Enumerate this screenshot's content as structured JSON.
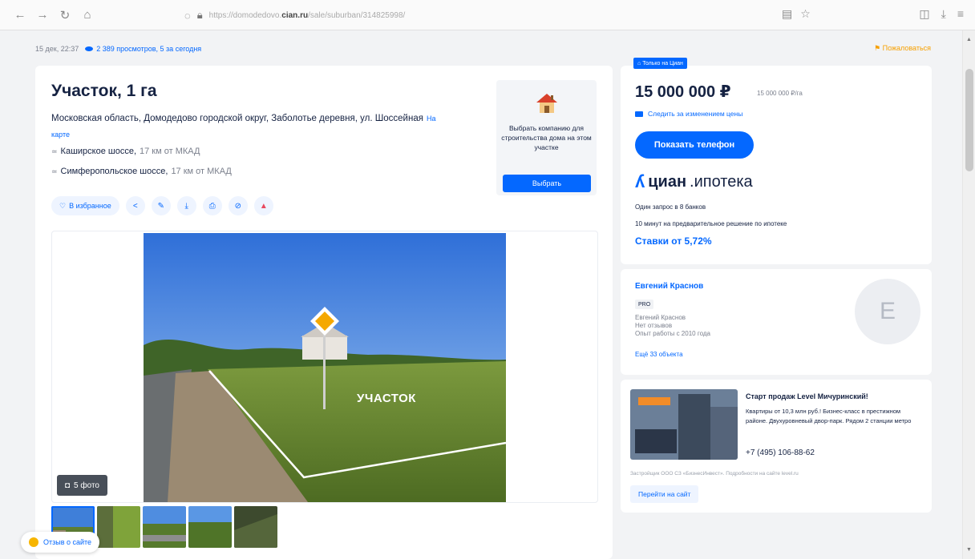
{
  "browser": {
    "url_prefix": "https://domodedovo.",
    "url_host": "cian.ru",
    "url_path": "/sale/suburban/314825998/"
  },
  "meta": {
    "date": "15 дек, 22:37",
    "views": "2 389 просмотров, 5 за сегодня",
    "complain": "Пожаловаться"
  },
  "listing": {
    "title": "Участок, 1 га",
    "address": "Московская область, Домодедово городской округ, Заболотье деревня, ул. Шоссейная",
    "map_link": "На карте",
    "highways": [
      {
        "name": "Каширское шоссе,",
        "distance": "17 км от МКАД"
      },
      {
        "name": "Симферопольское шоссе,",
        "distance": "17 км от МКАД"
      }
    ],
    "favorite": "В избранное"
  },
  "builder": {
    "text": "Выбрать компанию для строительства дома на этом участке",
    "button": "Выбрать"
  },
  "gallery": {
    "photo_label": "УЧАСТОК",
    "photo_count": "5 фото"
  },
  "feedback": "Отзыв о сайте",
  "price": {
    "badge": "Только на Циан",
    "amount": "15 000 000 ₽",
    "per_unit": "15 000 000 ₽/га",
    "watch": "Следить за изменением цены",
    "phone_button": "Показать телефон"
  },
  "mortgage": {
    "brand_main": "циан",
    "brand_sub": ".ипотека",
    "line1": "Один запрос в 8 банков",
    "line2": "10 минут на предварительное решение по ипотеке",
    "rates": "Ставки от 5,72%"
  },
  "agent": {
    "name": "Евгений Краснов",
    "pro": "PRO",
    "info1": "Евгений Краснов",
    "info2": "Нет отзывов",
    "info3": "Опыт работы с 2010 года",
    "more": "Ещё 33 объекта",
    "initial": "Е"
  },
  "ad": {
    "title": "Старт продаж Level Мичуринский!",
    "text": "Квартиры от 10,3 млн руб.! Бизнес-класс в престижном районе. Двухуровневый двор-парк. Рядом 2 станции метро",
    "phone": "+7 (495) 106-88-62",
    "developer": "Застройщик ООО СЗ «БизнесИнвест». Подробности на сайте level.ru",
    "button": "Перейти на сайт"
  },
  "colors": {
    "accent": "#0468ff",
    "text": "#152242",
    "muted": "#7a7f8c"
  }
}
